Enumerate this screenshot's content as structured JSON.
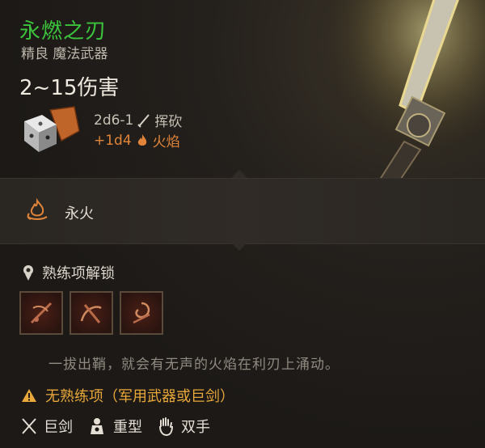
{
  "item": {
    "name": "永燃之刃",
    "rarity_type": "精良 魔法武器",
    "damage_range": "2~15伤害",
    "damage_primary": "2d6-1",
    "damage_primary_type": "挥砍",
    "damage_bonus": "+1d4",
    "damage_bonus_type": "火焰"
  },
  "passive": {
    "label": "永火",
    "icon": "flame-aura-icon"
  },
  "proficiency": {
    "header": "熟练项解锁",
    "slots": [
      {
        "icon": "cleave-skill-icon"
      },
      {
        "icon": "lacerate-skill-icon"
      },
      {
        "icon": "whirl-skill-icon"
      }
    ]
  },
  "flavor_text": "一拔出鞘，就会有无声的火焰在利刃上涌动。",
  "warning": "无熟练项（军用武器或巨剑）",
  "properties": [
    {
      "label": "巨剑",
      "icon": "crossed-swords-icon"
    },
    {
      "label": "重型",
      "icon": "heavy-weight-icon"
    },
    {
      "label": "双手",
      "icon": "hand-icon"
    }
  ],
  "colors": {
    "name": "#3cc43c",
    "fire": "#e0843a",
    "warning": "#e8a83a"
  }
}
